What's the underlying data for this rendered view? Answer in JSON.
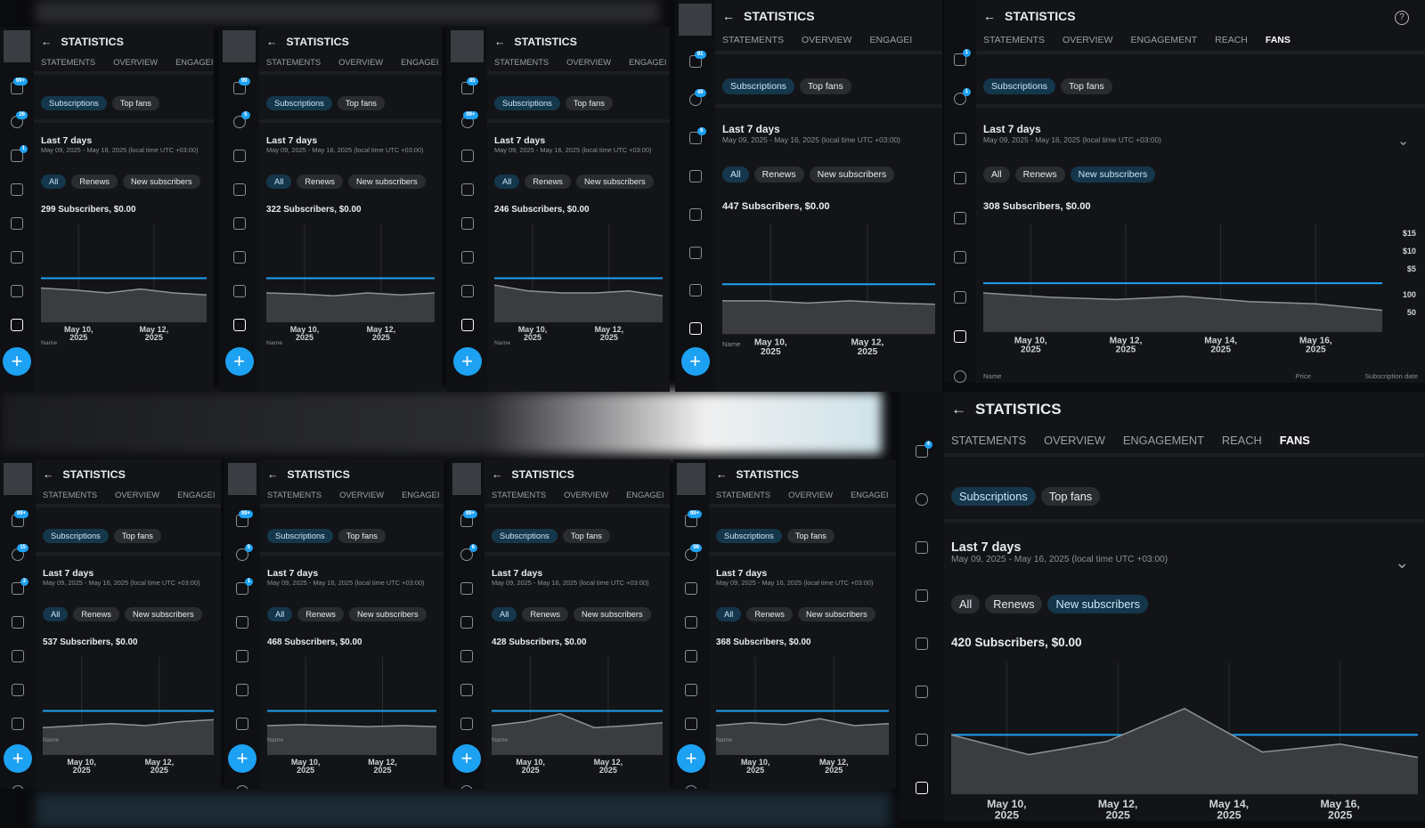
{
  "common": {
    "title": "STATISTICS",
    "back_glyph": "←",
    "tabs": [
      "STATEMENTS",
      "OVERVIEW",
      "ENGAGEMENT",
      "REACH",
      "FANS"
    ],
    "tab_engagement_truncated": "ENGAGEI",
    "pills": [
      "Subscriptions",
      "Top fans"
    ],
    "period_title": "Last 7 days",
    "period_range": "May 09, 2025 - May 16, 2025 (local time UTC +03:00)",
    "filters": [
      "All",
      "Renews",
      "New subscribers"
    ],
    "x_ticks_short": [
      "May 10,\n2025",
      "May 12,\n2025"
    ],
    "x_ticks_long": [
      "May 10,\n2025",
      "May 12,\n2025",
      "May 14,\n2025",
      "May 16,\n2025"
    ],
    "name_col": "Name",
    "price_col": "Price",
    "date_col": "Subscription date",
    "y_ticks": [
      "$15",
      "$10",
      "$5",
      "100",
      "50"
    ],
    "fab_glyph": "+",
    "help_glyph": "?",
    "chevron_glyph": "⌄",
    "icons": [
      "home-icon",
      "bell-icon",
      "chat-icon",
      "bookmark-icon",
      "gallery-icon",
      "calendar-icon",
      "stats-icon",
      "trending-icon",
      "more-icon"
    ],
    "accent": "#1da1f2"
  },
  "panels": [
    {
      "id": "p1",
      "total": "299 Subscribers, $0.00",
      "badges": [
        "99+",
        "26",
        "1"
      ],
      "trend": [
        0.35,
        0.33,
        0.3,
        0.34,
        0.3,
        0.28
      ]
    },
    {
      "id": "p2",
      "total": "322 Subscribers, $0.00",
      "badges": [
        "99",
        "5"
      ],
      "trend": [
        0.3,
        0.29,
        0.27,
        0.3,
        0.28,
        0.3
      ]
    },
    {
      "id": "p3",
      "total": "246 Subscribers, $0.00",
      "badges": [
        "85",
        "99+"
      ],
      "trend": [
        0.38,
        0.32,
        0.3,
        0.3,
        0.32,
        0.27
      ]
    },
    {
      "id": "p4",
      "total": "447 Subscribers, $0.00",
      "badges": [
        "91",
        "49",
        "6"
      ],
      "trend": [
        0.3,
        0.3,
        0.28,
        0.3,
        0.28,
        0.27
      ]
    },
    {
      "id": "p5",
      "total": "308 Subscribers, $0.00",
      "badges": [
        "1",
        "1"
      ],
      "trend": [
        0.36,
        0.32,
        0.3,
        0.33,
        0.28,
        0.26,
        0.2
      ]
    },
    {
      "id": "p6",
      "total": "537 Subscribers, $0.00",
      "badges": [
        "99+",
        "15",
        "3"
      ],
      "trend": [
        0.28,
        0.3,
        0.32,
        0.3,
        0.34,
        0.36
      ]
    },
    {
      "id": "p7",
      "total": "468 Subscribers, $0.00",
      "badges": [
        "99+",
        "5",
        "1"
      ],
      "trend": [
        0.3,
        0.31,
        0.3,
        0.29,
        0.3,
        0.29
      ]
    },
    {
      "id": "p8",
      "total": "428 Subscribers, $0.00",
      "badges": [
        "99+",
        "6"
      ],
      "trend": [
        0.3,
        0.34,
        0.42,
        0.28,
        0.3,
        0.33
      ]
    },
    {
      "id": "p9",
      "total": "368 Subscribers, $0.00",
      "badges": [
        "99+",
        "98"
      ],
      "trend": [
        0.3,
        0.33,
        0.31,
        0.37,
        0.3,
        0.32
      ]
    },
    {
      "id": "p10",
      "total": "420 Subscribers, $0.00",
      "badges": [
        "4"
      ],
      "trend": [
        0.45,
        0.3,
        0.4,
        0.65,
        0.32,
        0.38,
        0.28
      ]
    }
  ]
}
